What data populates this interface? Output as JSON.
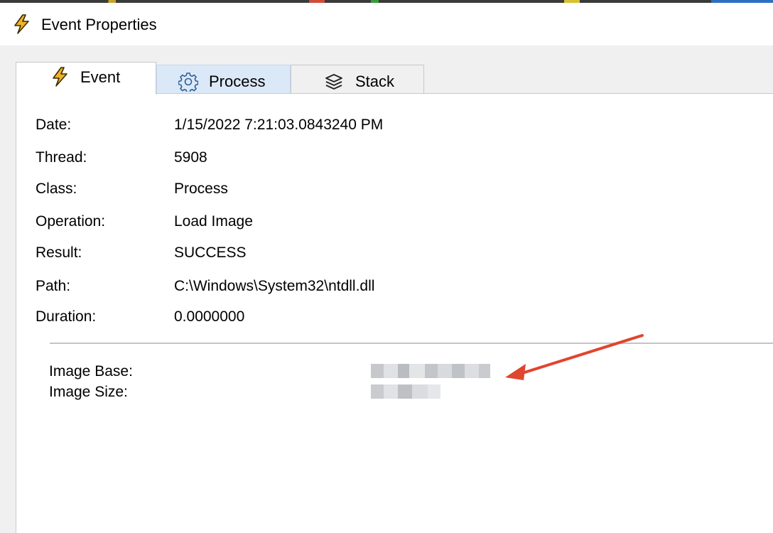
{
  "window": {
    "title": "Event Properties",
    "icon": "lightning-icon"
  },
  "tabs": [
    {
      "label": "Event",
      "icon": "lightning-icon",
      "selected": true
    },
    {
      "label": "Process",
      "icon": "gear-icon",
      "selected": false
    },
    {
      "label": "Stack",
      "icon": "stack-layers-icon",
      "selected": false
    }
  ],
  "event": {
    "date_label": "Date:",
    "date_value": "1/15/2022 7:21:03.0843240 PM",
    "thread_label": "Thread:",
    "thread_value": "5908",
    "class_label": "Class:",
    "class_value": "Process",
    "operation_label": "Operation:",
    "operation_value": "Load Image",
    "result_label": "Result:",
    "result_value": "SUCCESS",
    "path_label": "Path:",
    "path_value": "C:\\Windows\\System32\\ntdll.dll",
    "duration_label": "Duration:",
    "duration_value": "0.0000000"
  },
  "details": {
    "image_base_label": "Image Base:",
    "image_size_label": "Image Size:"
  },
  "colors": {
    "annotation_arrow": "#e0452f",
    "tab_hover": "#dbe8f7",
    "icon_lightning": "#f0b323"
  }
}
